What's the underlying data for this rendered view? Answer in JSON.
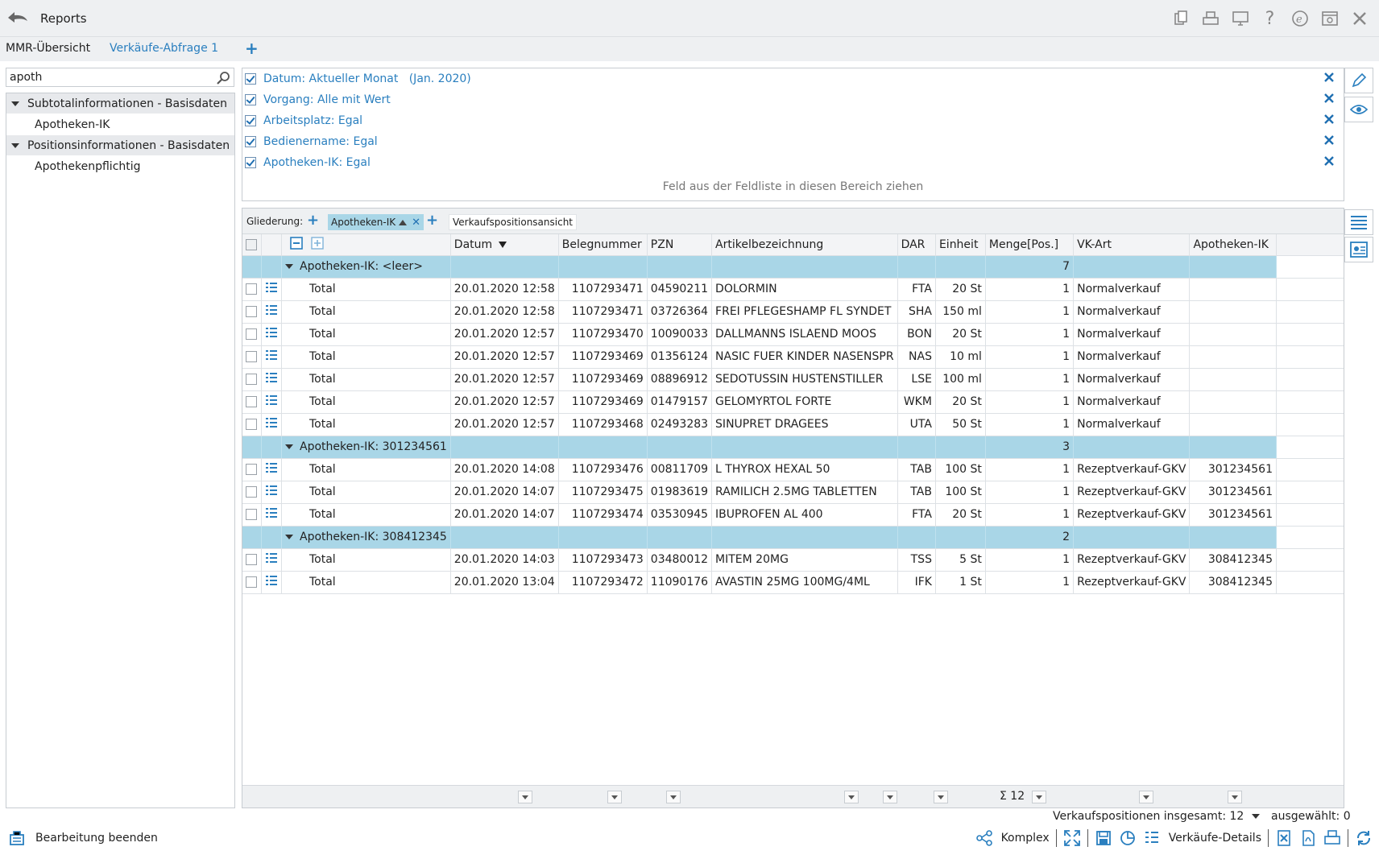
{
  "app": {
    "title": "Reports"
  },
  "tabs": [
    {
      "label": "MMR-Übersicht"
    },
    {
      "label": "Verkäufe-Abfrage 1"
    }
  ],
  "search": {
    "value": "apoth",
    "placeholder": ""
  },
  "fieldlist": {
    "groups": [
      {
        "label": "Subtotalinformationen - Basisdaten",
        "items": [
          "Apotheken-IK"
        ]
      },
      {
        "label": "Positionsinformationen - Basisdaten",
        "items": [
          "Apothekenpflichtig"
        ]
      }
    ]
  },
  "filters": [
    {
      "label": "Datum: Aktueller Monat   (Jan. 2020)"
    },
    {
      "label": "Vorgang: Alle mit Wert"
    },
    {
      "label": "Arbeitsplatz: Egal"
    },
    {
      "label": "Bedienername: Egal"
    },
    {
      "label": "Apotheken-IK: Egal"
    }
  ],
  "filter_drop_hint": "Feld aus der Feldliste in diesen Bereich ziehen",
  "grouping": {
    "label": "Gliederung:",
    "chip": "Apotheken-IK",
    "view": "Verkaufspositionsansicht"
  },
  "grid": {
    "columns": [
      "Datum",
      "Belegnummer",
      "PZN",
      "Artikelbezeichnung",
      "DAR",
      "Einheit",
      "Menge[Pos.]",
      "VK-Art",
      "Apotheken-IK"
    ],
    "groups": [
      {
        "label": "Apotheken-IK: <leer>",
        "count": "7",
        "rows": [
          {
            "name": "Total",
            "datum": "20.01.2020 12:58",
            "beleg": "1107293471",
            "pzn": "04590211",
            "artikel": "DOLORMIN",
            "dar": "FTA",
            "einheit": "20 St",
            "menge": "1",
            "vkart": "Normalverkauf",
            "ik": ""
          },
          {
            "name": "Total",
            "datum": "20.01.2020 12:58",
            "beleg": "1107293471",
            "pzn": "03726364",
            "artikel": "FREI PFLEGESHAMP FL SYNDET",
            "dar": "SHA",
            "einheit": "150 ml",
            "menge": "1",
            "vkart": "Normalverkauf",
            "ik": ""
          },
          {
            "name": "Total",
            "datum": "20.01.2020 12:57",
            "beleg": "1107293470",
            "pzn": "10090033",
            "artikel": "DALLMANNS ISLAEND MOOS",
            "dar": "BON",
            "einheit": "20 St",
            "menge": "1",
            "vkart": "Normalverkauf",
            "ik": ""
          },
          {
            "name": "Total",
            "datum": "20.01.2020 12:57",
            "beleg": "1107293469",
            "pzn": "01356124",
            "artikel": "NASIC FUER KINDER NASENSPR",
            "dar": "NAS",
            "einheit": "10 ml",
            "menge": "1",
            "vkart": "Normalverkauf",
            "ik": ""
          },
          {
            "name": "Total",
            "datum": "20.01.2020 12:57",
            "beleg": "1107293469",
            "pzn": "08896912",
            "artikel": "SEDOTUSSIN HUSTENSTILLER",
            "dar": "LSE",
            "einheit": "100 ml",
            "menge": "1",
            "vkart": "Normalverkauf",
            "ik": ""
          },
          {
            "name": "Total",
            "datum": "20.01.2020 12:57",
            "beleg": "1107293469",
            "pzn": "01479157",
            "artikel": "GELOMYRTOL FORTE",
            "dar": "WKM",
            "einheit": "20 St",
            "menge": "1",
            "vkart": "Normalverkauf",
            "ik": ""
          },
          {
            "name": "Total",
            "datum": "20.01.2020 12:57",
            "beleg": "1107293468",
            "pzn": "02493283",
            "artikel": "SINUPRET DRAGEES",
            "dar": "UTA",
            "einheit": "50 St",
            "menge": "1",
            "vkart": "Normalverkauf",
            "ik": ""
          }
        ]
      },
      {
        "label": "Apotheken-IK: 301234561",
        "count": "3",
        "rows": [
          {
            "name": "Total",
            "datum": "20.01.2020 14:08",
            "beleg": "1107293476",
            "pzn": "00811709",
            "artikel": "L THYROX HEXAL 50",
            "dar": "TAB",
            "einheit": "100 St",
            "menge": "1",
            "vkart": "Rezeptverkauf-GKV",
            "ik": "301234561"
          },
          {
            "name": "Total",
            "datum": "20.01.2020 14:07",
            "beleg": "1107293475",
            "pzn": "01983619",
            "artikel": "RAMILICH 2.5MG TABLETTEN",
            "dar": "TAB",
            "einheit": "100 St",
            "menge": "1",
            "vkart": "Rezeptverkauf-GKV",
            "ik": "301234561"
          },
          {
            "name": "Total",
            "datum": "20.01.2020 14:07",
            "beleg": "1107293474",
            "pzn": "03530945",
            "artikel": "IBUPROFEN AL 400",
            "dar": "FTA",
            "einheit": "20 St",
            "menge": "1",
            "vkart": "Rezeptverkauf-GKV",
            "ik": "301234561"
          }
        ]
      },
      {
        "label": "Apotheken-IK: 308412345",
        "count": "2",
        "rows": [
          {
            "name": "Total",
            "datum": "20.01.2020 14:03",
            "beleg": "1107293473",
            "pzn": "03480012",
            "artikel": "MITEM 20MG",
            "dar": "TSS",
            "einheit": "5 St",
            "menge": "1",
            "vkart": "Rezeptverkauf-GKV",
            "ik": "308412345"
          },
          {
            "name": "Total",
            "datum": "20.01.2020 13:04",
            "beleg": "1107293472",
            "pzn": "11090176",
            "artikel": "AVASTIN 25MG 100MG/4ML",
            "dar": "IFK",
            "einheit": "1 St",
            "menge": "1",
            "vkart": "Rezeptverkauf-GKV",
            "ik": "308412345"
          }
        ]
      }
    ],
    "footer_sum": "Σ 12"
  },
  "status": {
    "total": "Verkaufspositionen insgesamt: 12",
    "selected": "ausgewählt: 0"
  },
  "bottom": {
    "left_label": "Bearbeitung beenden",
    "komplex_label": "Komplex",
    "details_label": "Verkäufe-Details"
  },
  "colors": {
    "accent": "#2a7fbf",
    "group_row": "#a9d6e7",
    "close_x": "#1f6fb2"
  }
}
